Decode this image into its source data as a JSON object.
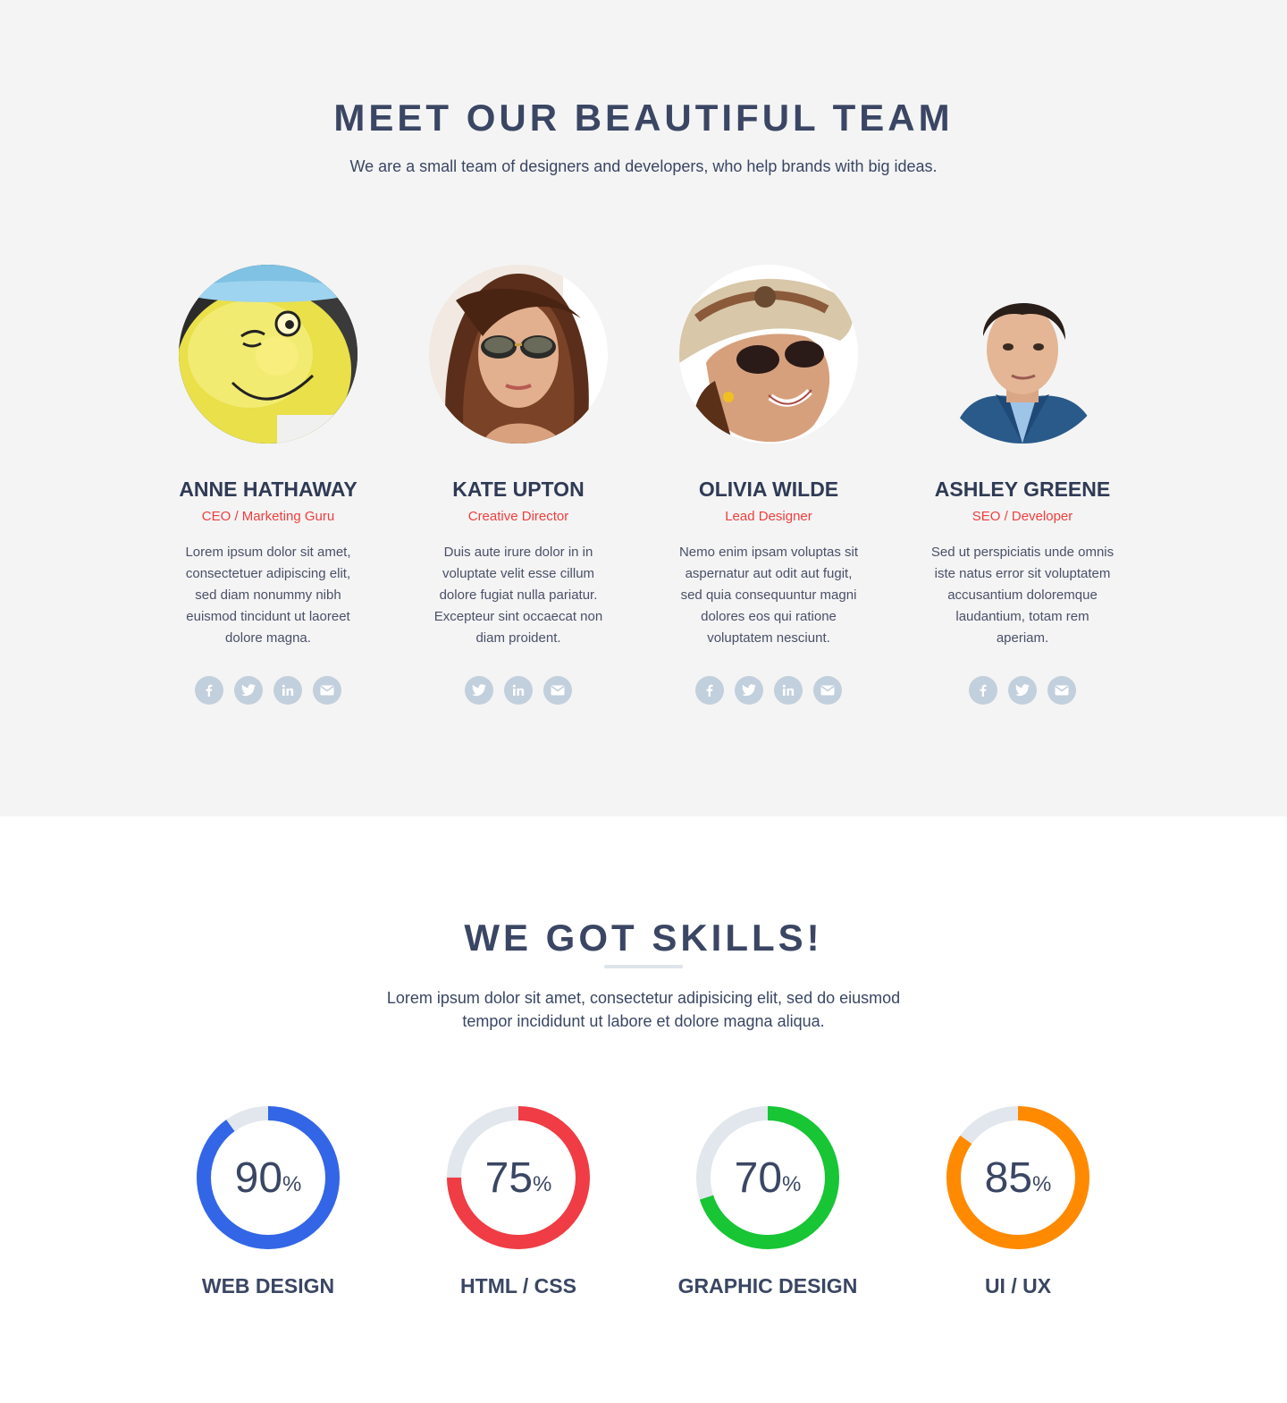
{
  "team": {
    "title": "MEET OUR BEAUTIFUL TEAM",
    "subtitle": "We are a small team of designers and developers, who help brands with big ideas.",
    "members": [
      {
        "name": "ANNE HATHAWAY",
        "role": "CEO / Marketing Guru",
        "bio": "Lorem ipsum dolor sit amet, consectetuer adipiscing elit, sed diam nonummy nibh euismod tincidunt ut laoreet dolore magna.",
        "socials": [
          "facebook-icon",
          "twitter-icon",
          "linkedin-icon",
          "email-icon"
        ],
        "photo": "smiley-mug"
      },
      {
        "name": "KATE UPTON",
        "role": "Creative Director",
        "bio": "Duis aute irure dolor in in voluptate velit esse cillum dolore fugiat nulla pariatur. Excepteur sint occaecat non diam proident.",
        "socials": [
          "twitter-icon",
          "linkedin-icon",
          "email-icon"
        ],
        "photo": "woman-sunglasses"
      },
      {
        "name": "OLIVIA WILDE",
        "role": "Lead Designer",
        "bio": "Nemo enim ipsam voluptas sit aspernatur aut odit aut fugit, sed quia consequuntur magni dolores eos qui ratione voluptatem nesciunt.",
        "socials": [
          "facebook-icon",
          "twitter-icon",
          "linkedin-icon",
          "email-icon"
        ],
        "photo": "woman-sunhat"
      },
      {
        "name": "ASHLEY GREENE",
        "role": "SEO / Developer",
        "bio": "Sed ut perspiciatis unde omnis iste natus error sit voluptatem accusantium doloremque laudantium, totam rem aperiam.",
        "socials": [
          "facebook-icon",
          "twitter-icon",
          "email-icon"
        ],
        "photo": "man-suit"
      }
    ]
  },
  "skills": {
    "title": "WE GOT SKILLS!",
    "subtitle": "Lorem ipsum dolor sit amet, consectetur adipisicing elit, sed do eiusmod tempor incididunt ut labore et dolore magna aliqua.",
    "items": [
      {
        "label": "WEB DESIGN",
        "value": "90",
        "unit": "%",
        "percent": 90,
        "color": "#3366e6"
      },
      {
        "label": "HTML / CSS",
        "value": "75",
        "unit": "%",
        "percent": 75,
        "color": "#f03c44"
      },
      {
        "label": "GRAPHIC DESIGN",
        "value": "70",
        "unit": "%",
        "percent": 70,
        "color": "#17c535"
      },
      {
        "label": "UI / UX",
        "value": "85",
        "unit": "%",
        "percent": 85,
        "color": "#ff8a00"
      }
    ],
    "track_color": "#e1e7ec"
  }
}
